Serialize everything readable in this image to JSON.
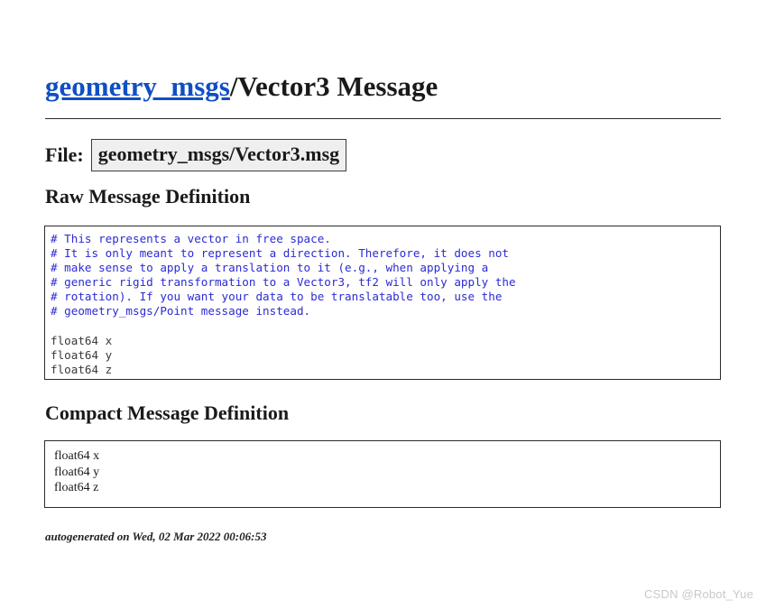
{
  "page": {
    "background_color": "#ffffff",
    "link_color": "#0e4fc4",
    "comment_color": "#2b2bd4",
    "field_color": "#3a3a3a",
    "box_border_color": "#2b2b2b",
    "file_box_background": "#efefef",
    "watermark_color": "#c8c8c8"
  },
  "title": {
    "package_link": "geometry_msgs",
    "rest": "/Vector3 Message"
  },
  "file": {
    "label": "File:",
    "value": "geometry_msgs/Vector3.msg"
  },
  "sections": {
    "raw_heading": "Raw Message Definition",
    "compact_heading": "Compact Message Definition"
  },
  "raw_definition": {
    "comment_lines": [
      "# This represents a vector in free space.",
      "# It is only meant to represent a direction. Therefore, it does not",
      "# make sense to apply a translation to it (e.g., when applying a",
      "# generic rigid transformation to a Vector3, tf2 will only apply the",
      "# rotation). If you want your data to be translatable too, use the",
      "# geometry_msgs/Point message instead."
    ],
    "field_lines": [
      "float64 x",
      "float64 y",
      "float64 z"
    ],
    "comment_text": "# This represents a vector in free space.\n# It is only meant to represent a direction. Therefore, it does not\n# make sense to apply a translation to it (e.g., when applying a\n# generic rigid transformation to a Vector3, tf2 will only apply the\n# rotation). If you want your data to be translatable too, use the\n# geometry_msgs/Point message instead.",
    "fields_text": "float64 x\nfloat64 y\nfloat64 z"
  },
  "compact_definition": {
    "lines": [
      "float64 x",
      "float64 y",
      "float64 z"
    ],
    "text": "float64 x\nfloat64 y\nfloat64 z"
  },
  "footer": {
    "note": "autogenerated on Wed, 02 Mar 2022 00:06:53"
  },
  "watermark": {
    "text": "CSDN @Robot_Yue"
  }
}
